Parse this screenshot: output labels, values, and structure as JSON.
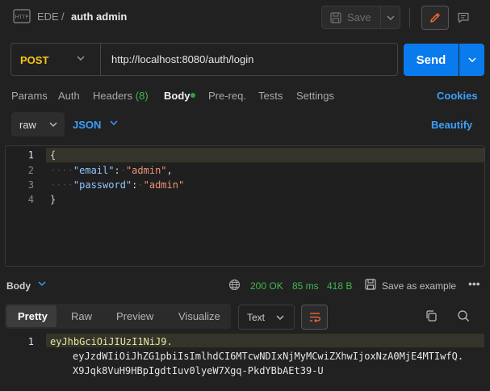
{
  "header": {
    "workspace": "EDE",
    "separator": "/",
    "request_name": "auth admin",
    "save_label": "Save",
    "app_icon_label": "HTTP"
  },
  "url_bar": {
    "method": "POST",
    "url": "http://localhost:8080/auth/login",
    "send_label": "Send"
  },
  "request_tabs": {
    "params": "Params",
    "auth": "Auth",
    "headers": "Headers",
    "headers_count": "(8)",
    "body": "Body",
    "prereq": "Pre-req.",
    "tests": "Tests",
    "settings": "Settings",
    "cookies": "Cookies"
  },
  "body_options": {
    "mode": "raw",
    "language": "JSON",
    "beautify": "Beautify"
  },
  "editor": {
    "line_numbers": [
      "1",
      "2",
      "3",
      "4"
    ],
    "open_brace": "{",
    "close_brace": "}",
    "email_key": "\"email\"",
    "email_value": "\"admin\"",
    "password_key": "\"password\"",
    "password_value": "\"admin\""
  },
  "response": {
    "label": "Body",
    "status": "200 OK",
    "time": "85 ms",
    "size": "418 B",
    "save_example": "Save as example",
    "tabs": {
      "pretty": "Pretty",
      "raw": "Raw",
      "preview": "Preview",
      "visualize": "Visualize"
    },
    "format": "Text",
    "line_number": "1",
    "token_line_1": "eyJhbGciOiJIUzI1NiJ9.",
    "token_line_2": "eyJzdWIiOiJhZG1pbiIsImlhdCI6MTcwNDIxNjMyMCwiZXhwIjoxNzA0MjE4MTIwfQ.",
    "token_line_3": "X9Jqk8VuH9HBpIgdtIuv0lyeW7Xgq-PkdYBbAEt39-U"
  },
  "colors": {
    "accent": "#097bed",
    "method": "#f5c518",
    "success": "#3fb950",
    "link": "#3aa0ff"
  }
}
